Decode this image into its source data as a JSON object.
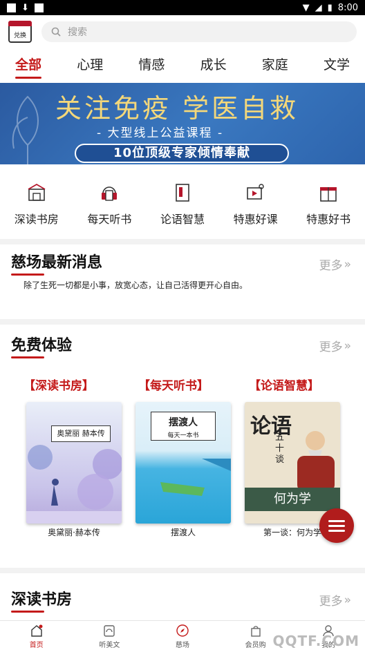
{
  "status": {
    "time": "8:00"
  },
  "header": {
    "calendar_label": "兑换",
    "search_placeholder": "搜索"
  },
  "tabs": [
    {
      "label": "全部",
      "active": true
    },
    {
      "label": "心理"
    },
    {
      "label": "情感"
    },
    {
      "label": "成长"
    },
    {
      "label": "家庭"
    },
    {
      "label": "文学"
    }
  ],
  "banner": {
    "headline": "关注免疫 学医自救",
    "subtitle": "- 大型线上公益课程 -",
    "caption": "10位顶级专家倾情奉献"
  },
  "categories": [
    {
      "label": "深读书房",
      "icon": "bookstore-icon"
    },
    {
      "label": "每天听书",
      "icon": "radio-icon"
    },
    {
      "label": "论语智慧",
      "icon": "book-icon"
    },
    {
      "label": "特惠好课",
      "icon": "video-lesson-icon"
    },
    {
      "label": "特惠好书",
      "icon": "gift-icon"
    }
  ],
  "news": {
    "title": "慈场最新消息",
    "more": "更多",
    "text": "除了生死一切都是小事，放宽心态，让自己活得更开心自由。"
  },
  "free": {
    "title": "免费体验",
    "more": "更多",
    "books": [
      {
        "tag": "【深读书房】",
        "cover_title": "奥黛丽 赫本传",
        "name": "奥黛丽·赫本传"
      },
      {
        "tag": "【每天听书】",
        "cover_title": "摆渡人",
        "cover_sub": "每天一本书",
        "name": "摆渡人"
      },
      {
        "tag": "【论语智慧】",
        "cover_title": "论语",
        "cover_sub": "五十谈",
        "cover_bottom": "何为学",
        "name": "第一谈：何为学"
      }
    ]
  },
  "reading": {
    "title": "深读书房",
    "more": "更多"
  },
  "bottom_nav": [
    {
      "label": "首页",
      "active": true
    },
    {
      "label": "听美文"
    },
    {
      "label": "慈场"
    },
    {
      "label": "会员购"
    },
    {
      "label": "我的"
    }
  ],
  "watermark": "QQTF.COM",
  "colors": {
    "accent": "#c41a1a",
    "banner": "#2d64ad"
  }
}
